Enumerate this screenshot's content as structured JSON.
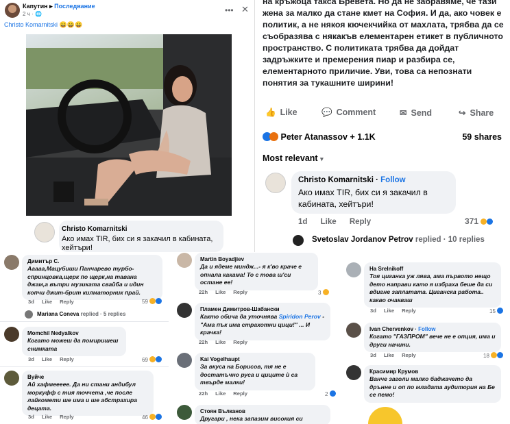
{
  "panel_a": {
    "author": "Капутин",
    "group": "Последвание",
    "time": "2 ч · ",
    "caption": "Christo Komarnitski",
    "caption_emoji": "😄😄😄",
    "comment": {
      "author": "Christo Komarnitski",
      "text": "Ако имах TIR, бих си я закачил в кабината, хейтъри!"
    }
  },
  "panel_b": {
    "post_text": "на кръжоца такса Бревета. Но да не забравяме, че тази жена за малко да стане кмет на София. И да, ако човек е политик, а не някоя кючекчийка от махлата, трябва да се съобразява с някакъв елементарен етикет в публичното пространство. С политиката трябва да дойдат задръжките и премерения пиар и разбира се, елементарното приличие. Уви, това са непознати понятия за тукашните ширини!",
    "actions": [
      "Like",
      "Comment",
      "Send",
      "Share"
    ],
    "reactions_text": "Peter Atanassov + 1.1K",
    "shares": "59 shares",
    "sort": "Most relevant",
    "comment": {
      "author": "Christo Komarnitski",
      "follow": "Follow",
      "text": "Ако имах TIR, бих си я закачил в кабината, хейтъри!",
      "time": "1d",
      "like": "Like",
      "reply": "Reply",
      "count": "371"
    },
    "reply_line": {
      "name": "Svetoslav Jordanov Petrov",
      "text": "replied · 10 replies"
    }
  },
  "col1": [
    {
      "name": "Димитър С.",
      "text": "Ааааа,Мацубиши Панчарево турбо-спринцовка,щерк по щерк,на тавана джам,а вътри музиката свайба и идин копчи джит-брит килматорник прай.",
      "time": "3d",
      "like": "Like",
      "reply": "Reply",
      "count": "59"
    },
    {
      "reply_name": "Mariana Coneva",
      "reply_text": "replied · 5 replies"
    },
    {
      "name": "Momchil Nedyalkov",
      "text": "Когато можеш да помиришеш снимката",
      "time": "3d",
      "like": "Like",
      "reply": "Reply",
      "count": "69"
    },
    {
      "name": "Вуйче",
      "text": "Ай хафмеееее. Да ни стани андибул моркуфф с тия точчета ,че после лайкомети ше има и ше абстрахира децата.",
      "time": "3d",
      "like": "Like",
      "reply": "Reply",
      "count": "46"
    }
  ],
  "col2": [
    {
      "name": "Martin Boyadjiev",
      "text": "Да и ядеме миндж...- я к'во краче е опнала какама! То с това ш'си остане ее!",
      "time": "22h",
      "like": "Like",
      "reply": "Reply",
      "count": "3"
    },
    {
      "name": "Пламен Димитров-Шабански",
      "text_a": "Както обича да уточнява ",
      "mention": "Spiridon Perov",
      "text_b": " - \"Ама пък има страхотни цици!\" ... И крачка!",
      "time": "22h",
      "like": "Like",
      "reply": "Reply"
    },
    {
      "name": "Kai Vogelhaupt",
      "text": "За вкуса на Борисов, тя не е достатъчно руса и циците ѝ са твърде малки!",
      "time": "22h",
      "like": "Like",
      "reply": "Reply",
      "count": "2"
    },
    {
      "name": "Стоян Вълканов",
      "text": "Другари , нека запазим високия си"
    }
  ],
  "col3": [
    {
      "name": "Ha Srelnikoff",
      "text": "Тоя циганка уж лява, ама първото нещо дето направи като я избраха беше да си вдигне заплатата. Циганска работа.. какво очакваш",
      "time": "3d",
      "like": "Like",
      "reply": "Reply",
      "count": "15"
    },
    {
      "name": "Ivan Chervenkov",
      "follow": "Follow",
      "text": "Когато \"ГАЗПРОМ\" вече не е опция, има и други начини.",
      "time": "3d",
      "like": "Like",
      "reply": "Reply",
      "count": "18"
    },
    {
      "name": "Красимир Крумов",
      "text": "Ванче заголи малко баджачето да дрънне и оп по младата аудитория на Бе се пемо!"
    }
  ],
  "colors": {
    "accent": "#1b74e4",
    "haha": "#f7b125",
    "like": "#1b74e4",
    "text": "#050505",
    "muted": "#65676b"
  }
}
